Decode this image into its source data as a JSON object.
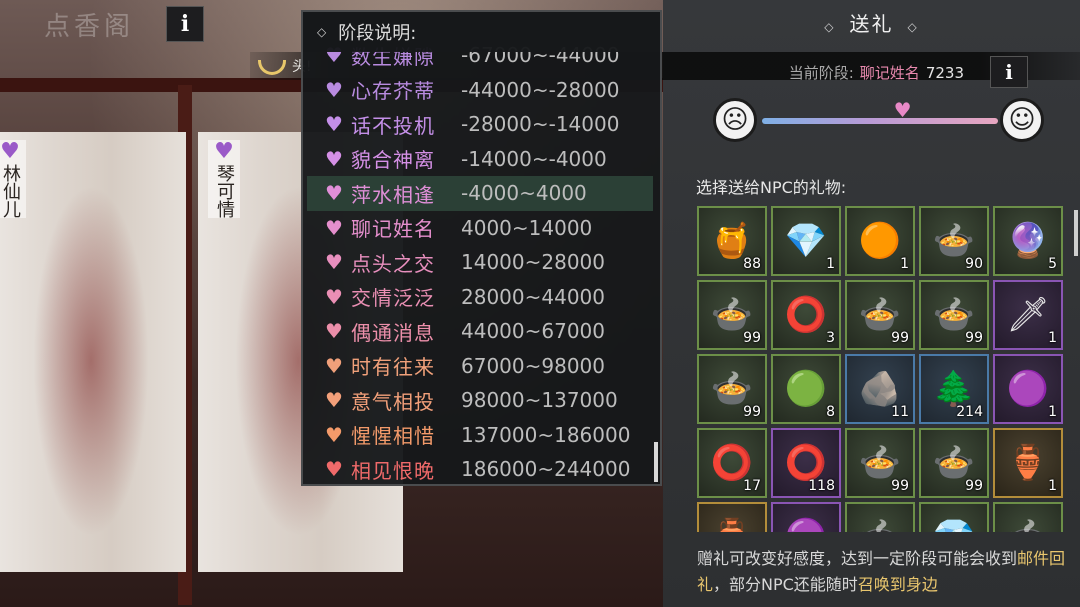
{
  "scene": {
    "title": "点香阁",
    "info_label": "i",
    "tags": [
      {
        "heart": "♥",
        "text": "林仙儿"
      },
      {
        "heart": "♥",
        "text": "琴可情"
      }
    ]
  },
  "banner": {
    "text": "头!"
  },
  "popup": {
    "title": "阶段说明:",
    "stages": [
      {
        "name": "数生嫌隙",
        "range": "-67000~-44000",
        "color": "#b98be0"
      },
      {
        "name": "心存芥蒂",
        "range": "-44000~-28000",
        "color": "#b98be0"
      },
      {
        "name": "话不投机",
        "range": "-28000~-14000",
        "color": "#c48fe8"
      },
      {
        "name": "貌合神离",
        "range": "-14000~-4000",
        "color": "#d590e6"
      },
      {
        "name": "萍水相逢",
        "range": "-4000~4000",
        "color": "#e08fd8",
        "active": true
      },
      {
        "name": "聊记姓名",
        "range": "4000~14000",
        "color": "#e58fcd"
      },
      {
        "name": "点头之交",
        "range": "14000~28000",
        "color": "#e88fbe"
      },
      {
        "name": "交情泛泛",
        "range": "28000~44000",
        "color": "#ea8fb4"
      },
      {
        "name": "偶通消息",
        "range": "44000~67000",
        "color": "#ec8faa"
      },
      {
        "name": "时有往来",
        "range": "67000~98000",
        "color": "#f0a07a"
      },
      {
        "name": "意气相投",
        "range": "98000~137000",
        "color": "#f3a07a"
      },
      {
        "name": "惺惺相惜",
        "range": "137000~186000",
        "color": "#f39a6a"
      },
      {
        "name": "相见恨晚",
        "range": "186000~244000",
        "color": "#f06a6a"
      }
    ]
  },
  "panel": {
    "title": "送礼",
    "current_stage_label": "当前阶段:",
    "current_stage_value": "聊记姓名",
    "current_stage_points": "7233",
    "info_label": "i",
    "affinity_fraction": 0.6,
    "gift_label": "选择送给NPC的礼物:",
    "gifts": [
      {
        "icon": "coin-jar-icon",
        "glyph": "🍯",
        "count": "88",
        "quality": "green"
      },
      {
        "icon": "blue-crystal-icon",
        "glyph": "💎",
        "count": "1",
        "quality": "green"
      },
      {
        "icon": "amber-disc-icon",
        "glyph": "🟠",
        "count": "1",
        "quality": "green"
      },
      {
        "icon": "berry-bowl-icon",
        "glyph": "🍲",
        "count": "90",
        "quality": "green"
      },
      {
        "icon": "gold-orb-icon",
        "glyph": "🔮",
        "count": "5",
        "quality": "green"
      },
      {
        "icon": "berry-bowl-icon",
        "glyph": "🍲",
        "count": "99",
        "quality": "green"
      },
      {
        "icon": "jade-ring-icon",
        "glyph": "⭕",
        "count": "3",
        "quality": "green"
      },
      {
        "icon": "berry-bowl-icon",
        "glyph": "🍲",
        "count": "99",
        "quality": "green"
      },
      {
        "icon": "berry-bowl-icon",
        "glyph": "🍲",
        "count": "99",
        "quality": "green"
      },
      {
        "icon": "jade-pendant-icon",
        "glyph": "🗡",
        "count": "1",
        "quality": "purple"
      },
      {
        "icon": "berry-bowl-icon",
        "glyph": "🍲",
        "count": "99",
        "quality": "green"
      },
      {
        "icon": "green-jade-ring-icon",
        "glyph": "🟢",
        "count": "8",
        "quality": "green"
      },
      {
        "icon": "rock-icon",
        "glyph": "🪨",
        "count": "11",
        "quality": "blue"
      },
      {
        "icon": "bonsai-icon",
        "glyph": "🌲",
        "count": "214",
        "quality": "blue"
      },
      {
        "icon": "purple-crystal-icon",
        "glyph": "🟣",
        "count": "1",
        "quality": "purple"
      },
      {
        "icon": "jade-ring-icon",
        "glyph": "⭕",
        "count": "17",
        "quality": "green"
      },
      {
        "icon": "jade-ring-icon",
        "glyph": "⭕",
        "count": "118",
        "quality": "purple"
      },
      {
        "icon": "berry-bowl-icon",
        "glyph": "🍲",
        "count": "99",
        "quality": "green"
      },
      {
        "icon": "berry-bowl-icon",
        "glyph": "🍲",
        "count": "99",
        "quality": "green"
      },
      {
        "icon": "incense-burner-icon",
        "glyph": "🏺",
        "count": "1",
        "quality": "gold"
      },
      {
        "icon": "vase-icon",
        "glyph": "🏺",
        "count": "",
        "quality": "gold"
      },
      {
        "icon": "purple-orb-icon",
        "glyph": "🟣",
        "count": "",
        "quality": "purple"
      },
      {
        "icon": "berry-bowl-icon",
        "glyph": "🍲",
        "count": "",
        "quality": "green"
      },
      {
        "icon": "red-crystal-icon",
        "glyph": "💎",
        "count": "",
        "quality": "green"
      },
      {
        "icon": "berry-bowl-icon",
        "glyph": "🍲",
        "count": "",
        "quality": "green"
      }
    ],
    "note_part1": "赠礼可改变好感度，达到一定阶段可能会收到",
    "note_hl1": "邮件回礼",
    "note_part2": "，部分NPC还能随时",
    "note_hl2": "召唤到身边"
  }
}
